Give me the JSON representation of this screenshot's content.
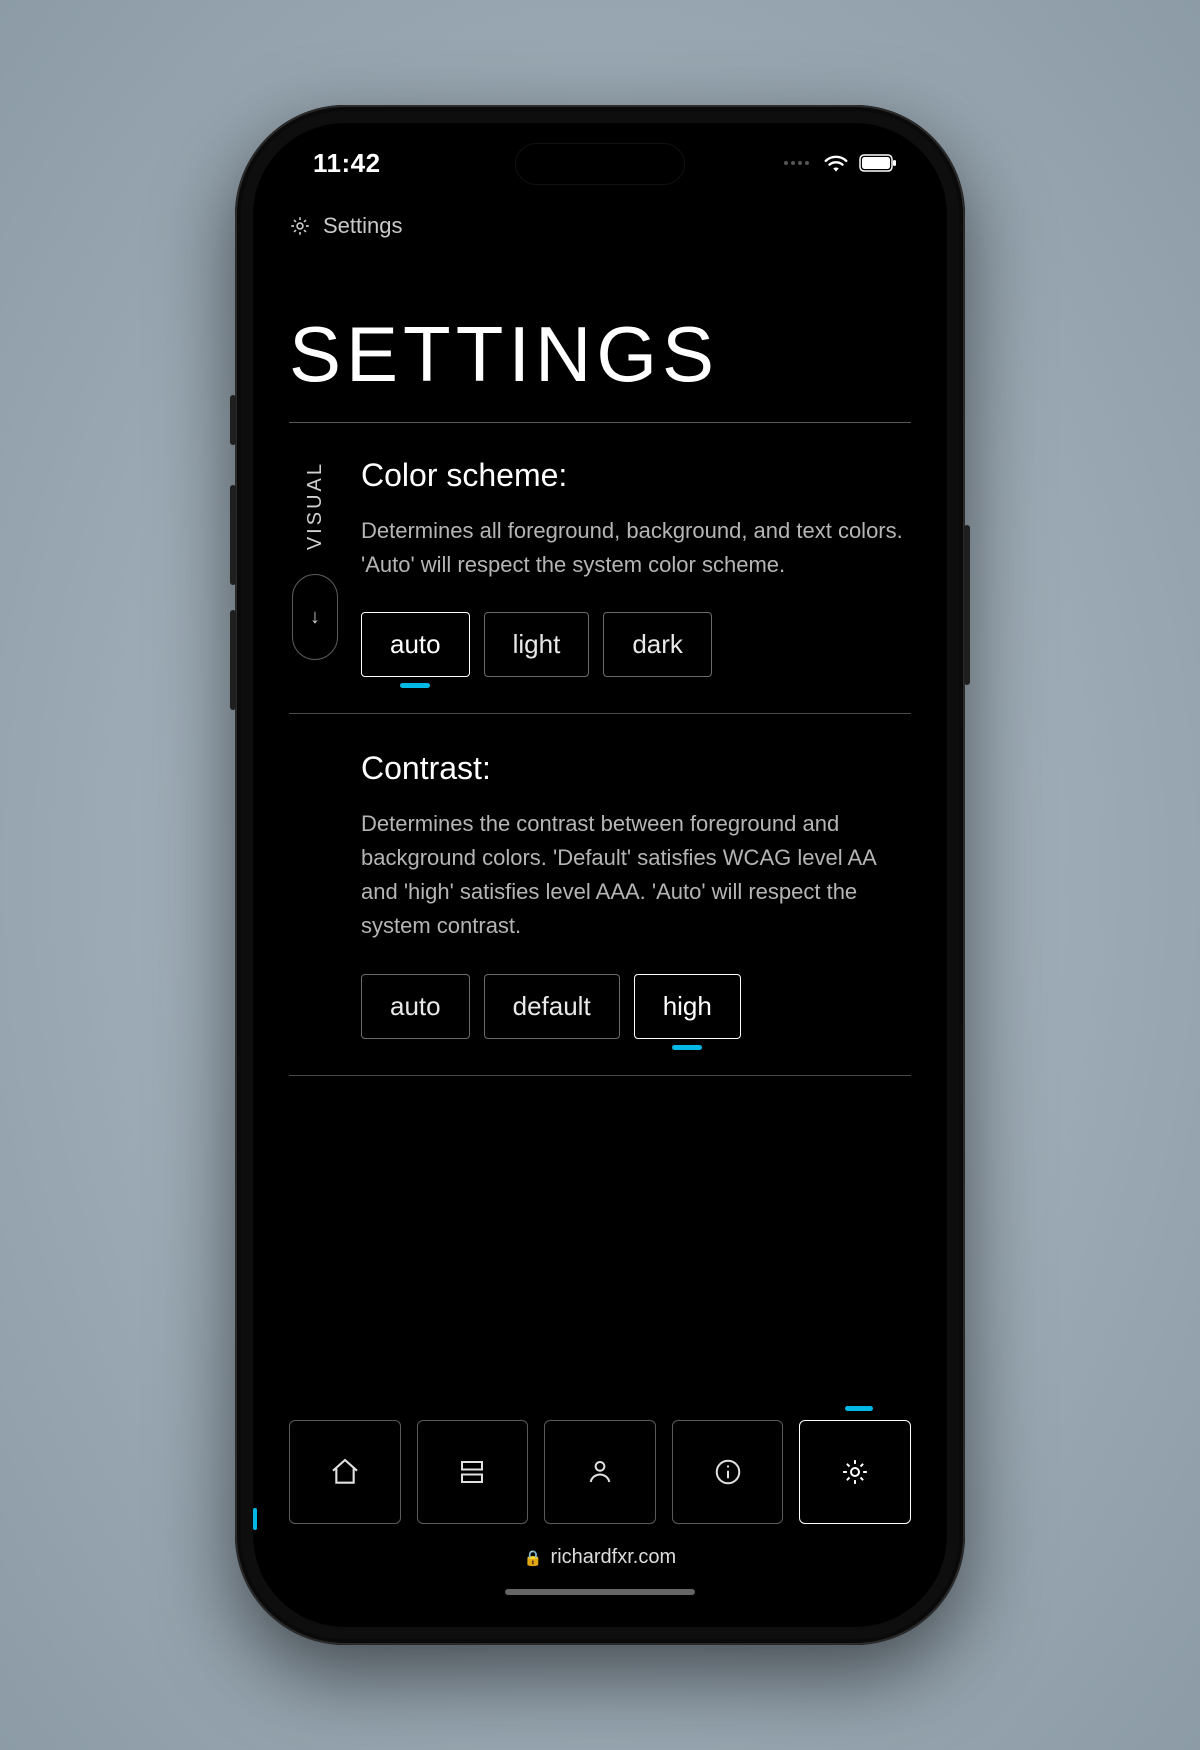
{
  "colors": {
    "accent": "#00b8e6",
    "bg": "#000000",
    "fg": "#ffffff",
    "muted": "#b5b5b5",
    "border": "#5a5a5a"
  },
  "status": {
    "time": "11:42"
  },
  "breadcrumb": {
    "icon": "gear-icon",
    "label": "Settings"
  },
  "page": {
    "title": "SETTINGS",
    "side_label": "VISUAL"
  },
  "sections": {
    "color_scheme": {
      "heading": "Color scheme:",
      "description": "Determines all foreground, background, and text colors. 'Auto' will respect the system color scheme.",
      "options": [
        "auto",
        "light",
        "dark"
      ],
      "selected": "auto"
    },
    "contrast": {
      "heading": "Contrast:",
      "description": "Determines the contrast between foreground and background colors. 'Default' satisfies WCAG level AA and 'high' satisfies level AAA. 'Auto' will respect the system contrast.",
      "options": [
        "auto",
        "default",
        "high"
      ],
      "selected": "high"
    }
  },
  "nav": {
    "items": [
      {
        "name": "home",
        "icon": "home-icon",
        "active": false
      },
      {
        "name": "projects",
        "icon": "list-icon",
        "active": false
      },
      {
        "name": "about",
        "icon": "person-icon",
        "active": false
      },
      {
        "name": "info",
        "icon": "info-icon",
        "active": false
      },
      {
        "name": "settings",
        "icon": "gear-icon",
        "active": true
      }
    ]
  },
  "browser": {
    "url": "richardfxr.com"
  }
}
